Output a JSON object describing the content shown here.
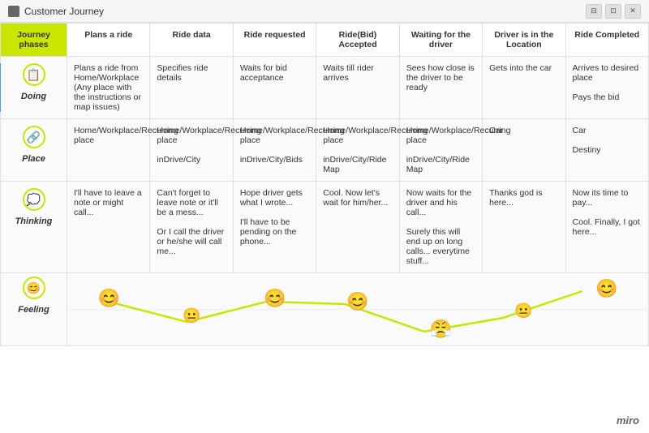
{
  "titlebar": {
    "title": "Customer Journey",
    "controls": [
      "⊟",
      "⊡",
      "✕"
    ]
  },
  "table": {
    "phase_header": "Journey phases",
    "columns": [
      "Plans a ride",
      "Ride data",
      "Ride requested",
      "Ride(Bid) Accepted",
      "Waiting for the driver",
      "Driver is in the Location",
      "Ride Completed"
    ],
    "rows": {
      "doing": {
        "label": "Doing",
        "icon": "📋",
        "cells": [
          "Plans a ride from Home/Workplace (Any place with the instructions or map issues)",
          "Specifies ride details",
          "Waits for bid acceptance",
          "Waits till rider arrives",
          "Sees how close is the driver to be ready",
          "Gets into the car",
          "Arrives to desired place\n\nPays the bid"
        ]
      },
      "place": {
        "label": "Place",
        "icon": "🔗",
        "cells": [
          "Home/Workplace/Recurring place",
          "Home/Workplace/Recurring place\n\ninDrive/City",
          "Home/Workplace/Recurring place\n\ninDrive/City/Bids",
          "Home/Workplace/Recurring place\n\ninDrive/City/Ride Map",
          "Home/Workplace/Recurring place\n\ninDrive/City/Ride Map",
          "Car",
          "Car\n\nDestiny"
        ]
      },
      "thinking": {
        "label": "Thinking",
        "icon": "🔗",
        "cells": [
          "I'll have to leave a note or might call...",
          "Can't forget to leave note or it'll be a mess...\n\nOr I call the driver or he/she will call me...",
          "Hope driver gets what I wrote...\n\nI'll have to be pending on the phone...",
          "Cool. Now let's wait for him/her...",
          "Now waits for the driver and his call...\n\nSurely this will end up on long calls... everytime stuff...",
          "Thanks god is here...",
          "Now its time to pay...\n\nCool. Finally, I got here..."
        ]
      },
      "feeling": {
        "label": "Feeling",
        "emojis": [
          "😊",
          "😐",
          "😊",
          "😊",
          "😤",
          "😐",
          "😊"
        ],
        "levels": [
          50,
          70,
          50,
          55,
          90,
          65,
          30
        ]
      }
    }
  },
  "miro": "miro"
}
